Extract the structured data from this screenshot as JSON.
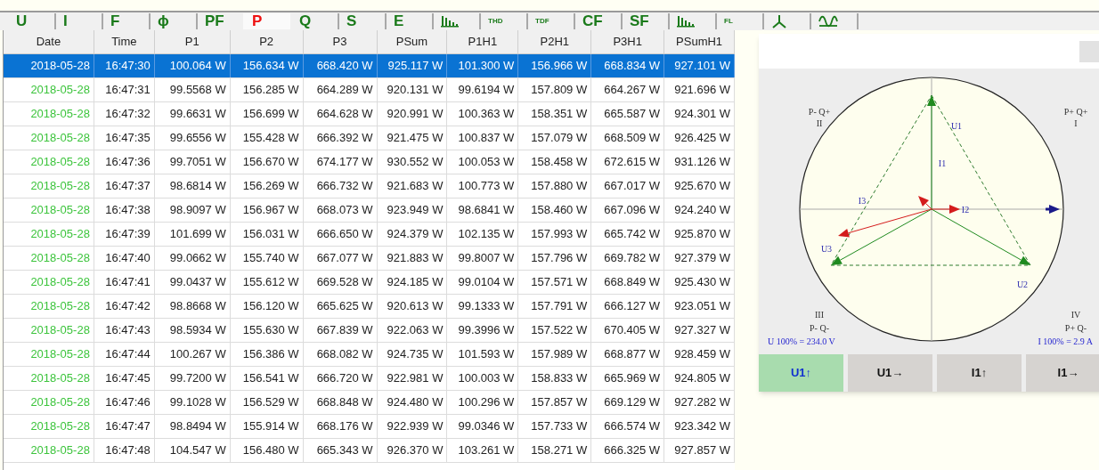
{
  "toolbar": [
    {
      "kind": "text",
      "label": "U",
      "selected": false
    },
    {
      "kind": "text",
      "label": "I",
      "selected": false
    },
    {
      "kind": "text",
      "label": "F",
      "selected": false
    },
    {
      "kind": "text",
      "label": "ϕ",
      "selected": false
    },
    {
      "kind": "text",
      "label": "PF",
      "selected": false
    },
    {
      "kind": "text",
      "label": "P",
      "selected": true
    },
    {
      "kind": "text",
      "label": "Q",
      "selected": false
    },
    {
      "kind": "text",
      "label": "S",
      "selected": false
    },
    {
      "kind": "text",
      "label": "E",
      "selected": false
    },
    {
      "kind": "bars",
      "selected": false
    },
    {
      "kind": "small",
      "label": "THD",
      "selected": false
    },
    {
      "kind": "small",
      "label": "TDF",
      "selected": false
    },
    {
      "kind": "text",
      "label": "CF",
      "selected": false
    },
    {
      "kind": "text",
      "label": "SF",
      "selected": false
    },
    {
      "kind": "bars",
      "selected": false
    },
    {
      "kind": "small",
      "label": "FL",
      "selected": false
    },
    {
      "kind": "phasor",
      "selected": false
    },
    {
      "kind": "wave",
      "selected": false
    }
  ],
  "table": {
    "columns": [
      "Date",
      "Time",
      "P1",
      "P2",
      "P3",
      "PSum",
      "P1H1",
      "P2H1",
      "P3H1",
      "PSumH1"
    ],
    "rows": [
      {
        "selected": true,
        "cells": [
          "2018-05-28",
          "16:47:30",
          "100.064 W",
          "156.634 W",
          "668.420 W",
          "925.117 W",
          "101.300 W",
          "156.966 W",
          "668.834 W",
          "927.101 W"
        ]
      },
      {
        "selected": false,
        "cells": [
          "2018-05-28",
          "16:47:31",
          "99.5568 W",
          "156.285 W",
          "664.289 W",
          "920.131 W",
          "99.6194 W",
          "157.809 W",
          "664.267 W",
          "921.696 W"
        ]
      },
      {
        "selected": false,
        "cells": [
          "2018-05-28",
          "16:47:32",
          "99.6631 W",
          "156.699 W",
          "664.628 W",
          "920.991 W",
          "100.363 W",
          "158.351 W",
          "665.587 W",
          "924.301 W"
        ]
      },
      {
        "selected": false,
        "cells": [
          "2018-05-28",
          "16:47:35",
          "99.6556 W",
          "155.428 W",
          "666.392 W",
          "921.475 W",
          "100.837 W",
          "157.079 W",
          "668.509 W",
          "926.425 W"
        ]
      },
      {
        "selected": false,
        "cells": [
          "2018-05-28",
          "16:47:36",
          "99.7051 W",
          "156.670 W",
          "674.177 W",
          "930.552 W",
          "100.053 W",
          "158.458 W",
          "672.615 W",
          "931.126 W"
        ]
      },
      {
        "selected": false,
        "cells": [
          "2018-05-28",
          "16:47:37",
          "98.6814 W",
          "156.269 W",
          "666.732 W",
          "921.683 W",
          "100.773 W",
          "157.880 W",
          "667.017 W",
          "925.670 W"
        ]
      },
      {
        "selected": false,
        "cells": [
          "2018-05-28",
          "16:47:38",
          "98.9097 W",
          "156.967 W",
          "668.073 W",
          "923.949 W",
          "98.6841 W",
          "158.460 W",
          "667.096 W",
          "924.240 W"
        ]
      },
      {
        "selected": false,
        "cells": [
          "2018-05-28",
          "16:47:39",
          "101.699 W",
          "156.031 W",
          "666.650 W",
          "924.379 W",
          "102.135 W",
          "157.993 W",
          "665.742 W",
          "925.870 W"
        ]
      },
      {
        "selected": false,
        "cells": [
          "2018-05-28",
          "16:47:40",
          "99.0662 W",
          "155.740 W",
          "667.077 W",
          "921.883 W",
          "99.8007 W",
          "157.796 W",
          "669.782 W",
          "927.379 W"
        ]
      },
      {
        "selected": false,
        "cells": [
          "2018-05-28",
          "16:47:41",
          "99.0437 W",
          "155.612 W",
          "669.528 W",
          "924.185 W",
          "99.0104 W",
          "157.571 W",
          "668.849 W",
          "925.430 W"
        ]
      },
      {
        "selected": false,
        "cells": [
          "2018-05-28",
          "16:47:42",
          "98.8668 W",
          "156.120 W",
          "665.625 W",
          "920.613 W",
          "99.1333 W",
          "157.791 W",
          "666.127 W",
          "923.051 W"
        ]
      },
      {
        "selected": false,
        "cells": [
          "2018-05-28",
          "16:47:43",
          "98.5934 W",
          "155.630 W",
          "667.839 W",
          "922.063 W",
          "99.3996 W",
          "157.522 W",
          "670.405 W",
          "927.327 W"
        ]
      },
      {
        "selected": false,
        "cells": [
          "2018-05-28",
          "16:47:44",
          "100.267 W",
          "156.386 W",
          "668.082 W",
          "924.735 W",
          "101.593 W",
          "157.989 W",
          "668.877 W",
          "928.459 W"
        ]
      },
      {
        "selected": false,
        "cells": [
          "2018-05-28",
          "16:47:45",
          "99.7200 W",
          "156.541 W",
          "666.720 W",
          "922.981 W",
          "100.003 W",
          "158.833 W",
          "665.969 W",
          "924.805 W"
        ]
      },
      {
        "selected": false,
        "cells": [
          "2018-05-28",
          "16:47:46",
          "99.1028 W",
          "156.529 W",
          "668.848 W",
          "924.480 W",
          "100.296 W",
          "157.857 W",
          "669.129 W",
          "927.282 W"
        ]
      },
      {
        "selected": false,
        "cells": [
          "2018-05-28",
          "16:47:47",
          "98.8494 W",
          "155.914 W",
          "668.176 W",
          "922.939 W",
          "99.0346 W",
          "157.733 W",
          "666.574 W",
          "923.342 W"
        ]
      },
      {
        "selected": false,
        "cells": [
          "2018-05-28",
          "16:47:48",
          "104.547 W",
          "156.480 W",
          "665.343 W",
          "926.370 W",
          "103.261 W",
          "158.271 W",
          "666.325 W",
          "927.857 W"
        ]
      }
    ]
  },
  "phasor_panel": {
    "quadrants": [
      {
        "signs": "P- Q+",
        "numeral": "II"
      },
      {
        "signs": "P+ Q+",
        "numeral": "I"
      },
      {
        "signs": "P- Q-",
        "numeral": "III"
      },
      {
        "signs": "P+ Q-",
        "numeral": "IV"
      }
    ],
    "vector_labels": [
      "U1",
      "I1",
      "I3",
      "I2",
      "U3",
      "U2"
    ],
    "scales": [
      "U 100% = 234.0 V",
      "I 100% = 2.9 A"
    ],
    "buttons": [
      {
        "label": "U1↑",
        "selected": true
      },
      {
        "label": "U1→",
        "selected": false
      },
      {
        "label": "I1↑",
        "selected": false
      },
      {
        "label": "I1→",
        "selected": false
      }
    ]
  }
}
